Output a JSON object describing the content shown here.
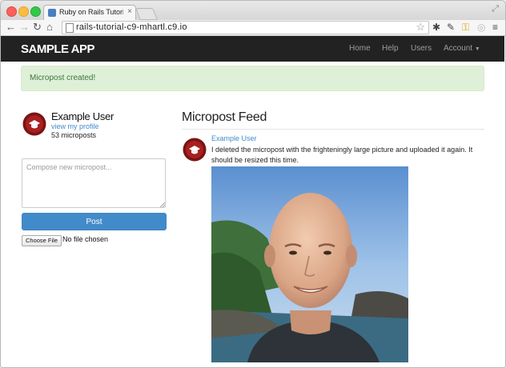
{
  "browser": {
    "tab_title": "Ruby on Rails Tutorial Sam",
    "tab_close": "×",
    "url": "rails-tutorial-c9-mhartl.c9.io"
  },
  "navbar": {
    "brand": "SAMPLE APP",
    "links": [
      "Home",
      "Help",
      "Users",
      "Account"
    ]
  },
  "flash": {
    "message": "Micropost created!"
  },
  "sidebar": {
    "user_name": "Example User",
    "profile_link": "view my profile",
    "micropost_count": "53 microposts",
    "compose_placeholder": "Compose new micropost...",
    "post_button": "Post",
    "choose_file_button": "Choose File",
    "file_status": "No file chosen"
  },
  "feed": {
    "title": "Micropost Feed",
    "post": {
      "user": "Example User",
      "content": "I deleted the micropost with the frighteningly large picture and uploaded it again. It should be resized this time."
    }
  },
  "colors": {
    "navbar_bg": "#222222",
    "link": "#428bca",
    "alert_bg": "#dff0d8",
    "alert_text": "#3c763d",
    "avatar": "#8b1a1a"
  }
}
